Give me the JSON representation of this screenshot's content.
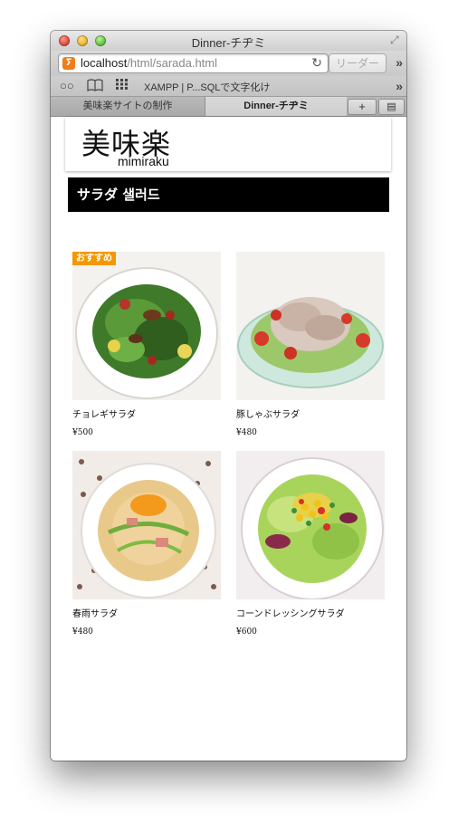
{
  "window": {
    "title": "Dinner-チヂミ"
  },
  "addressbar": {
    "host": "localhost",
    "path": "/html/sarada.html",
    "reader_label": "リーダー"
  },
  "bookmarks": {
    "link": "XAMPP | P...SQLで文字化け"
  },
  "tabs": [
    {
      "label": "美味楽サイトの制作"
    },
    {
      "label": "Dinner-チヂミ"
    }
  ],
  "site": {
    "logo_kanji": "美味楽",
    "logo_roman": "mimiraku",
    "section_title": "サラダ 샐러드"
  },
  "menu": [
    {
      "name": "チョレギサラダ",
      "price": "¥500",
      "badge": "おすすめ"
    },
    {
      "name": "豚しゃぶサラダ",
      "price": "¥480"
    },
    {
      "name": "春雨サラダ",
      "price": "¥480"
    },
    {
      "name": "コーンドレッシングサラダ",
      "price": "¥600"
    }
  ],
  "colors": {
    "badge": "#f39800",
    "section_bar": "#000000"
  }
}
